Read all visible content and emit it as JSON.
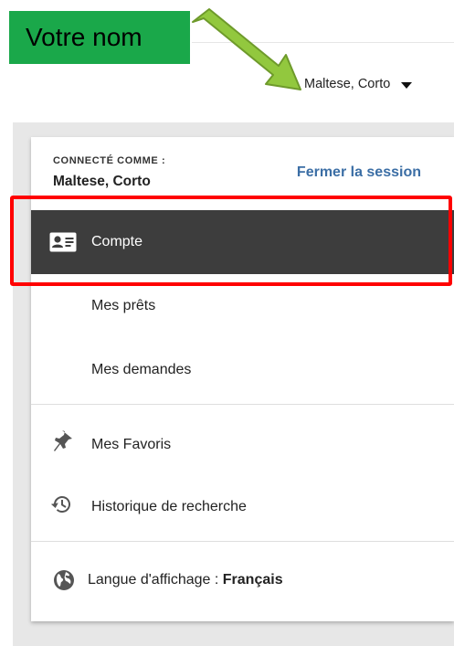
{
  "callout": {
    "text": "Votre nom",
    "color": "#1aa84a"
  },
  "header": {
    "user_name": "Maltese, Corto"
  },
  "menu": {
    "connected_label": "CONNECTÉ COMME :",
    "user_name": "Maltese, Corto",
    "logout_label": "Fermer la session",
    "items": [
      {
        "label": "Compte",
        "icon": "id-card-icon",
        "active": true
      },
      {
        "label": "Mes prêts"
      },
      {
        "label": "Mes demandes"
      },
      {
        "label": "Mes Favoris",
        "icon": "pin-icon"
      },
      {
        "label": "Historique de recherche",
        "icon": "history-icon"
      }
    ],
    "language": {
      "prefix": "Langue d'affichage : ",
      "value": "Français",
      "icon": "globe-icon"
    }
  },
  "colors": {
    "active_bg": "#3d3d3d",
    "link": "#3b6ea5",
    "highlight": "#ff0000"
  }
}
